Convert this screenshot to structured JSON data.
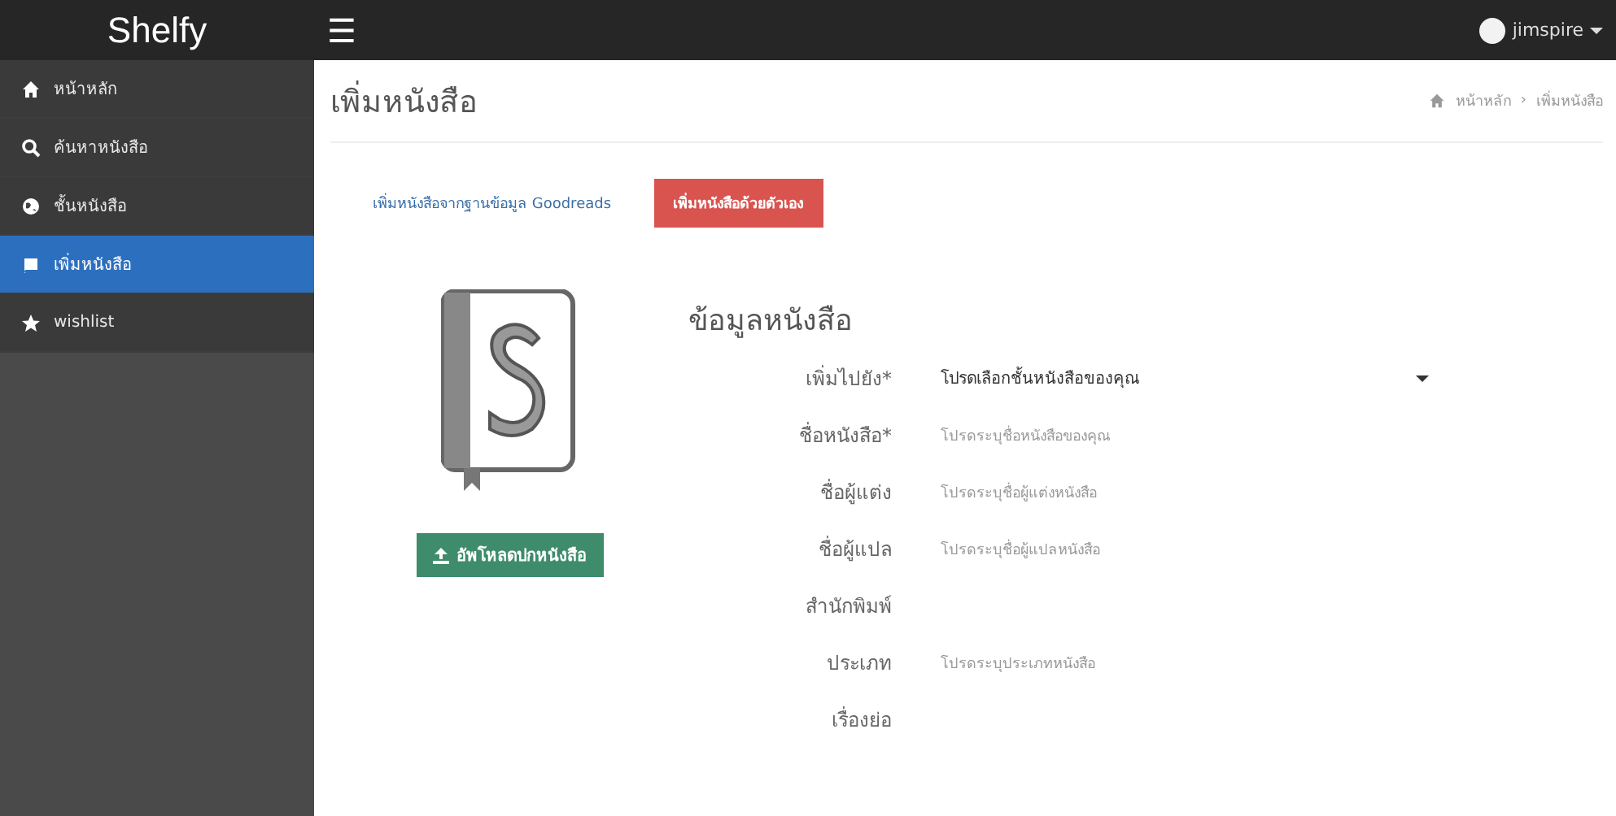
{
  "brand": "Shelfy",
  "menu_icon": "☰",
  "user": {
    "name": "jimspire"
  },
  "sidebar": {
    "items": [
      {
        "label": "หน้าหลัก",
        "selected": false
      },
      {
        "label": "ค้นหาหนังสือ",
        "selected": false
      },
      {
        "label": "ชั้นหนังสือ",
        "selected": false
      },
      {
        "label": "เพิ่มหนังสือ",
        "selected": true
      },
      {
        "label": "wishlist",
        "selected": false
      }
    ]
  },
  "page_title": "เพิ่มหนังสือ",
  "breadcrumb": [
    "หน้าหลัก",
    "เพิ่มหนังสือ"
  ],
  "breadcrumb_separator": "›",
  "tabs": [
    {
      "label": "เพิ่มหนังสือจากฐานข้อมูล Goodreads",
      "selected": false
    },
    {
      "label": "เพิ่มหนังสือด้วยตัวเอง",
      "selected": true
    }
  ],
  "upload_button": "อัพโหลดปกหนังสือ",
  "form": {
    "title": "ข้อมูลหนังสือ",
    "fields": [
      {
        "label": "เพิ่มไปยัง*",
        "kind": "select",
        "value": "โปรดเลือกชั้นหนังสือของคุณ"
      },
      {
        "label": "ชื่อหนังสือ*",
        "kind": "text",
        "placeholder": "โปรดระบุชื่อหนังสือของคุณ"
      },
      {
        "label": "ชื่อผู้แต่ง",
        "kind": "text",
        "placeholder": "โปรดระบุชื่อผู้แต่งหนังสือ"
      },
      {
        "label": "ชื่อผู้แปล",
        "kind": "text",
        "placeholder": "โปรดระบุชื่อผู้แปลหนังสือ"
      },
      {
        "label": "สำนักพิมพ์",
        "kind": "text"
      },
      {
        "label": "ประเภท",
        "kind": "text",
        "placeholder": "โปรดระบุประเภทหนังสือ"
      },
      {
        "label": "เรื่องย่อ",
        "kind": "text"
      }
    ]
  }
}
